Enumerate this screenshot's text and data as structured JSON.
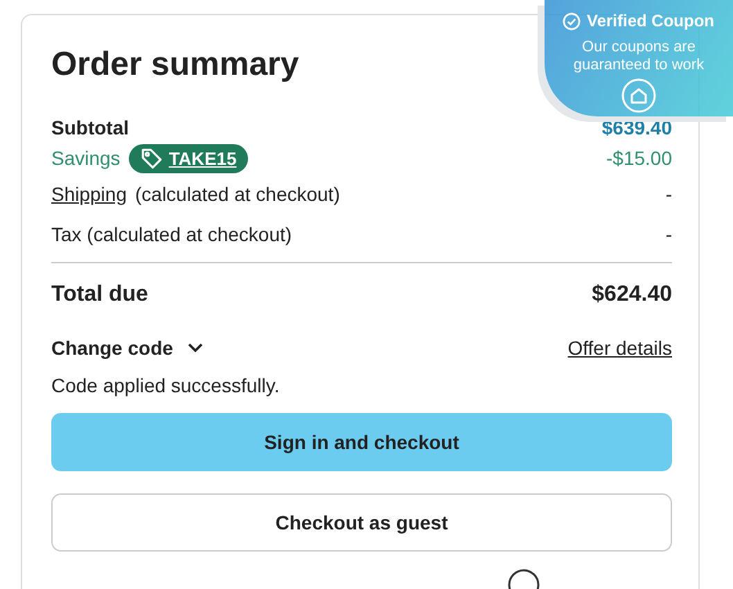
{
  "order_summary": {
    "title": "Order summary",
    "subtotal": {
      "label": "Subtotal",
      "value": "$639.40"
    },
    "savings": {
      "label": "Savings",
      "code": "TAKE15",
      "value": "-$15.00"
    },
    "shipping": {
      "link": "Shipping",
      "label": "(calculated at checkout)",
      "value": "-"
    },
    "tax": {
      "label": "Tax (calculated at checkout)",
      "value": "-"
    },
    "total": {
      "label": "Total due",
      "value": "$624.40"
    },
    "change_code": {
      "label": "Change code",
      "expanded": false
    },
    "offer_details": "Offer details",
    "message": "Code applied successfully.",
    "buttons": [
      {
        "label": "Sign in and checkout",
        "kind": "primary"
      },
      {
        "label": "Checkout as guest",
        "kind": "secondary"
      }
    ]
  },
  "coupon_badge": {
    "title": "Verified Coupon",
    "text": "Our coupons are guaranteed to work"
  }
}
